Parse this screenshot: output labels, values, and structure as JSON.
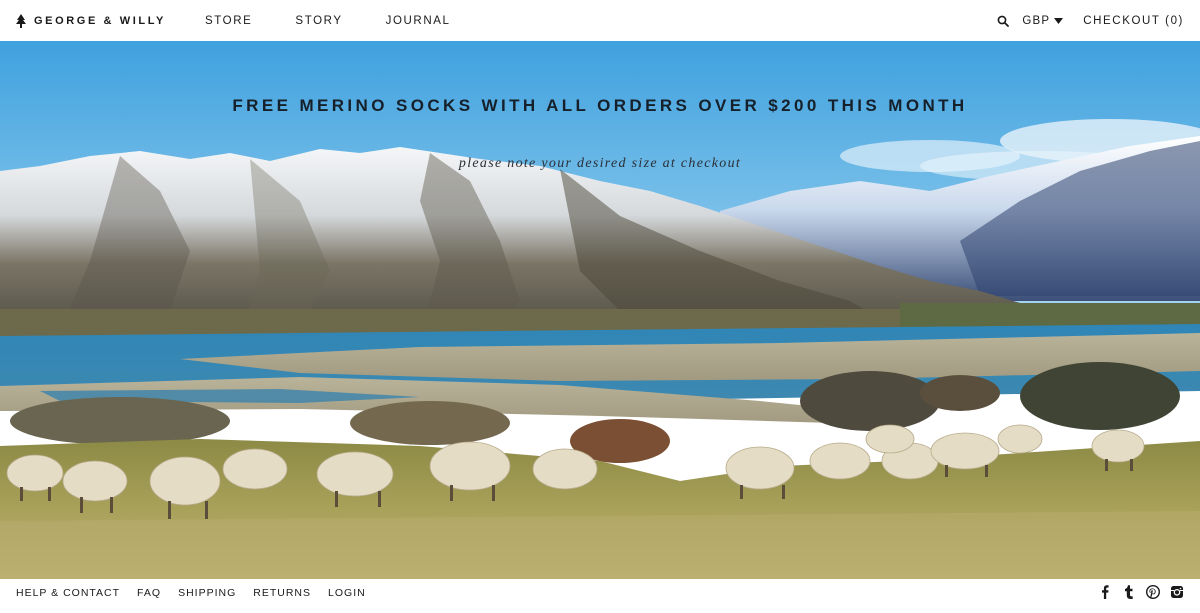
{
  "header": {
    "brand": "GEORGE & WILLY",
    "nav": [
      {
        "label": "STORE"
      },
      {
        "label": "STORY"
      },
      {
        "label": "JOURNAL"
      }
    ],
    "currency": "GBP",
    "checkout": "CHECKOUT (0)"
  },
  "hero": {
    "headline": "FREE MERINO SOCKS WITH ALL ORDERS OVER $200 THIS MONTH",
    "note": "please note your desired size at checkout"
  },
  "footer": {
    "links": [
      {
        "label": "HELP & CONTACT"
      },
      {
        "label": "FAQ"
      },
      {
        "label": "SHIPPING"
      },
      {
        "label": "RETURNS"
      },
      {
        "label": "LOGIN"
      }
    ],
    "social": [
      "facebook-icon",
      "tumblr-icon",
      "pinterest-icon",
      "instagram-icon"
    ]
  },
  "colors": {
    "text": "#1a1a1a",
    "sky": "#5bb0e2",
    "lake": "#2d6f9a",
    "grass": "#a29a52"
  }
}
